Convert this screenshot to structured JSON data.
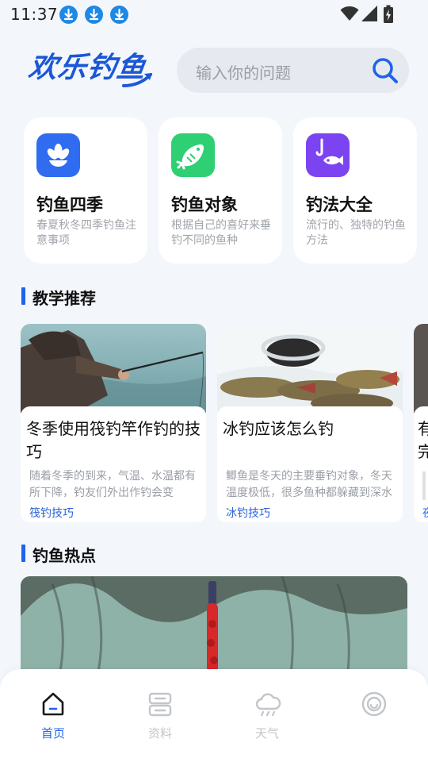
{
  "status_bar": {
    "time": "11:37",
    "notification_icons": [
      "download-icon",
      "download-icon",
      "download-icon"
    ],
    "system_icons": [
      "wifi-icon",
      "signal-icon",
      "battery-charging-icon"
    ]
  },
  "header": {
    "logo_text": "欢乐钓鱼",
    "search_placeholder": "输入你的问题"
  },
  "categories": [
    {
      "title": "钓鱼四季",
      "desc": "春夏秋冬四季钓鱼注意事项",
      "icon": "flower-icon",
      "color": "#2f6cf0"
    },
    {
      "title": "钓鱼对象",
      "desc": "根据自己的喜好来垂钓不同的鱼种",
      "icon": "fish-icon",
      "color": "#2fcf73"
    },
    {
      "title": "钓法大全",
      "desc": "流行的、独特的钓鱼方法",
      "icon": "hook-fish-icon",
      "color": "#7b44f0"
    }
  ],
  "sections": {
    "teaching": "教学推荐",
    "hot": "钓鱼热点"
  },
  "lessons": [
    {
      "title": "冬季使用筏钓竿作钓的技巧",
      "text": "随着冬季的到来，气温、水温都有所下降，钓友们外出作钓会变",
      "tag": "筏钓技巧"
    },
    {
      "title": "冰钓应该怎么钓",
      "text": "鲫鱼是冬天的主要垂钓对象，冬天温度极低，很多鱼种都躲藏到深水不再游动进食，由于鲫鱼耐",
      "tag": "冰钓技巧"
    }
  ],
  "lesson_peek": {
    "title_chars": [
      "有",
      "完"
    ],
    "tag_char": "夜"
  },
  "nav": {
    "items": [
      {
        "label": "首页",
        "icon": "home-icon",
        "active": true
      },
      {
        "label": "资料",
        "icon": "document-icon",
        "active": false
      },
      {
        "label": "天气",
        "icon": "weather-icon",
        "active": false
      },
      {
        "label": "",
        "icon": "smile-icon",
        "active": false
      }
    ]
  },
  "colors": {
    "accent": "#1e63e9",
    "background": "#f3f6fb",
    "inactive": "#c2c5ca"
  }
}
